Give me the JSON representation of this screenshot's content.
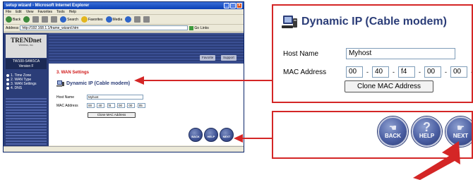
{
  "browser": {
    "title": "setup wizard - Microsoft Internet Explorer",
    "menu": [
      "File",
      "Edit",
      "View",
      "Favorites",
      "Tools",
      "Help"
    ],
    "toolbar": {
      "back": "Back",
      "search": "Search",
      "favorites": "Favorites",
      "media": "Media"
    },
    "address_label": "Address",
    "address_value": "http://192.168.1.1/frame_wizard.htm",
    "go_label": "Go",
    "links_label": "Links"
  },
  "router": {
    "brand": "TRENDnet",
    "tagline": "Wireless, Inc.",
    "model": "TW100-S4W1CA",
    "version": "Version F",
    "steps": [
      "1. Time Zone",
      "2. WAN Type",
      "3. WAN Settings",
      "4. DNS"
    ],
    "top_links": {
      "favorites": "Favorite",
      "support": "Support"
    }
  },
  "wan": {
    "section_title": "3. WAN Settings",
    "heading": "Dynamic IP (Cable modem)",
    "host_label": "Host Name",
    "host_value": "Myhost",
    "mac_label": "MAC Address",
    "mac_values": [
      "00",
      "40",
      "f4",
      "00",
      "00",
      "05"
    ],
    "clone_button": "Clone MAC Address"
  },
  "nav": {
    "back": "BACK",
    "help": "HELP",
    "next": "NEXT"
  },
  "colors": {
    "accent_red": "#d42626",
    "navy": "#2b3d78",
    "title": "#2b3d78"
  }
}
